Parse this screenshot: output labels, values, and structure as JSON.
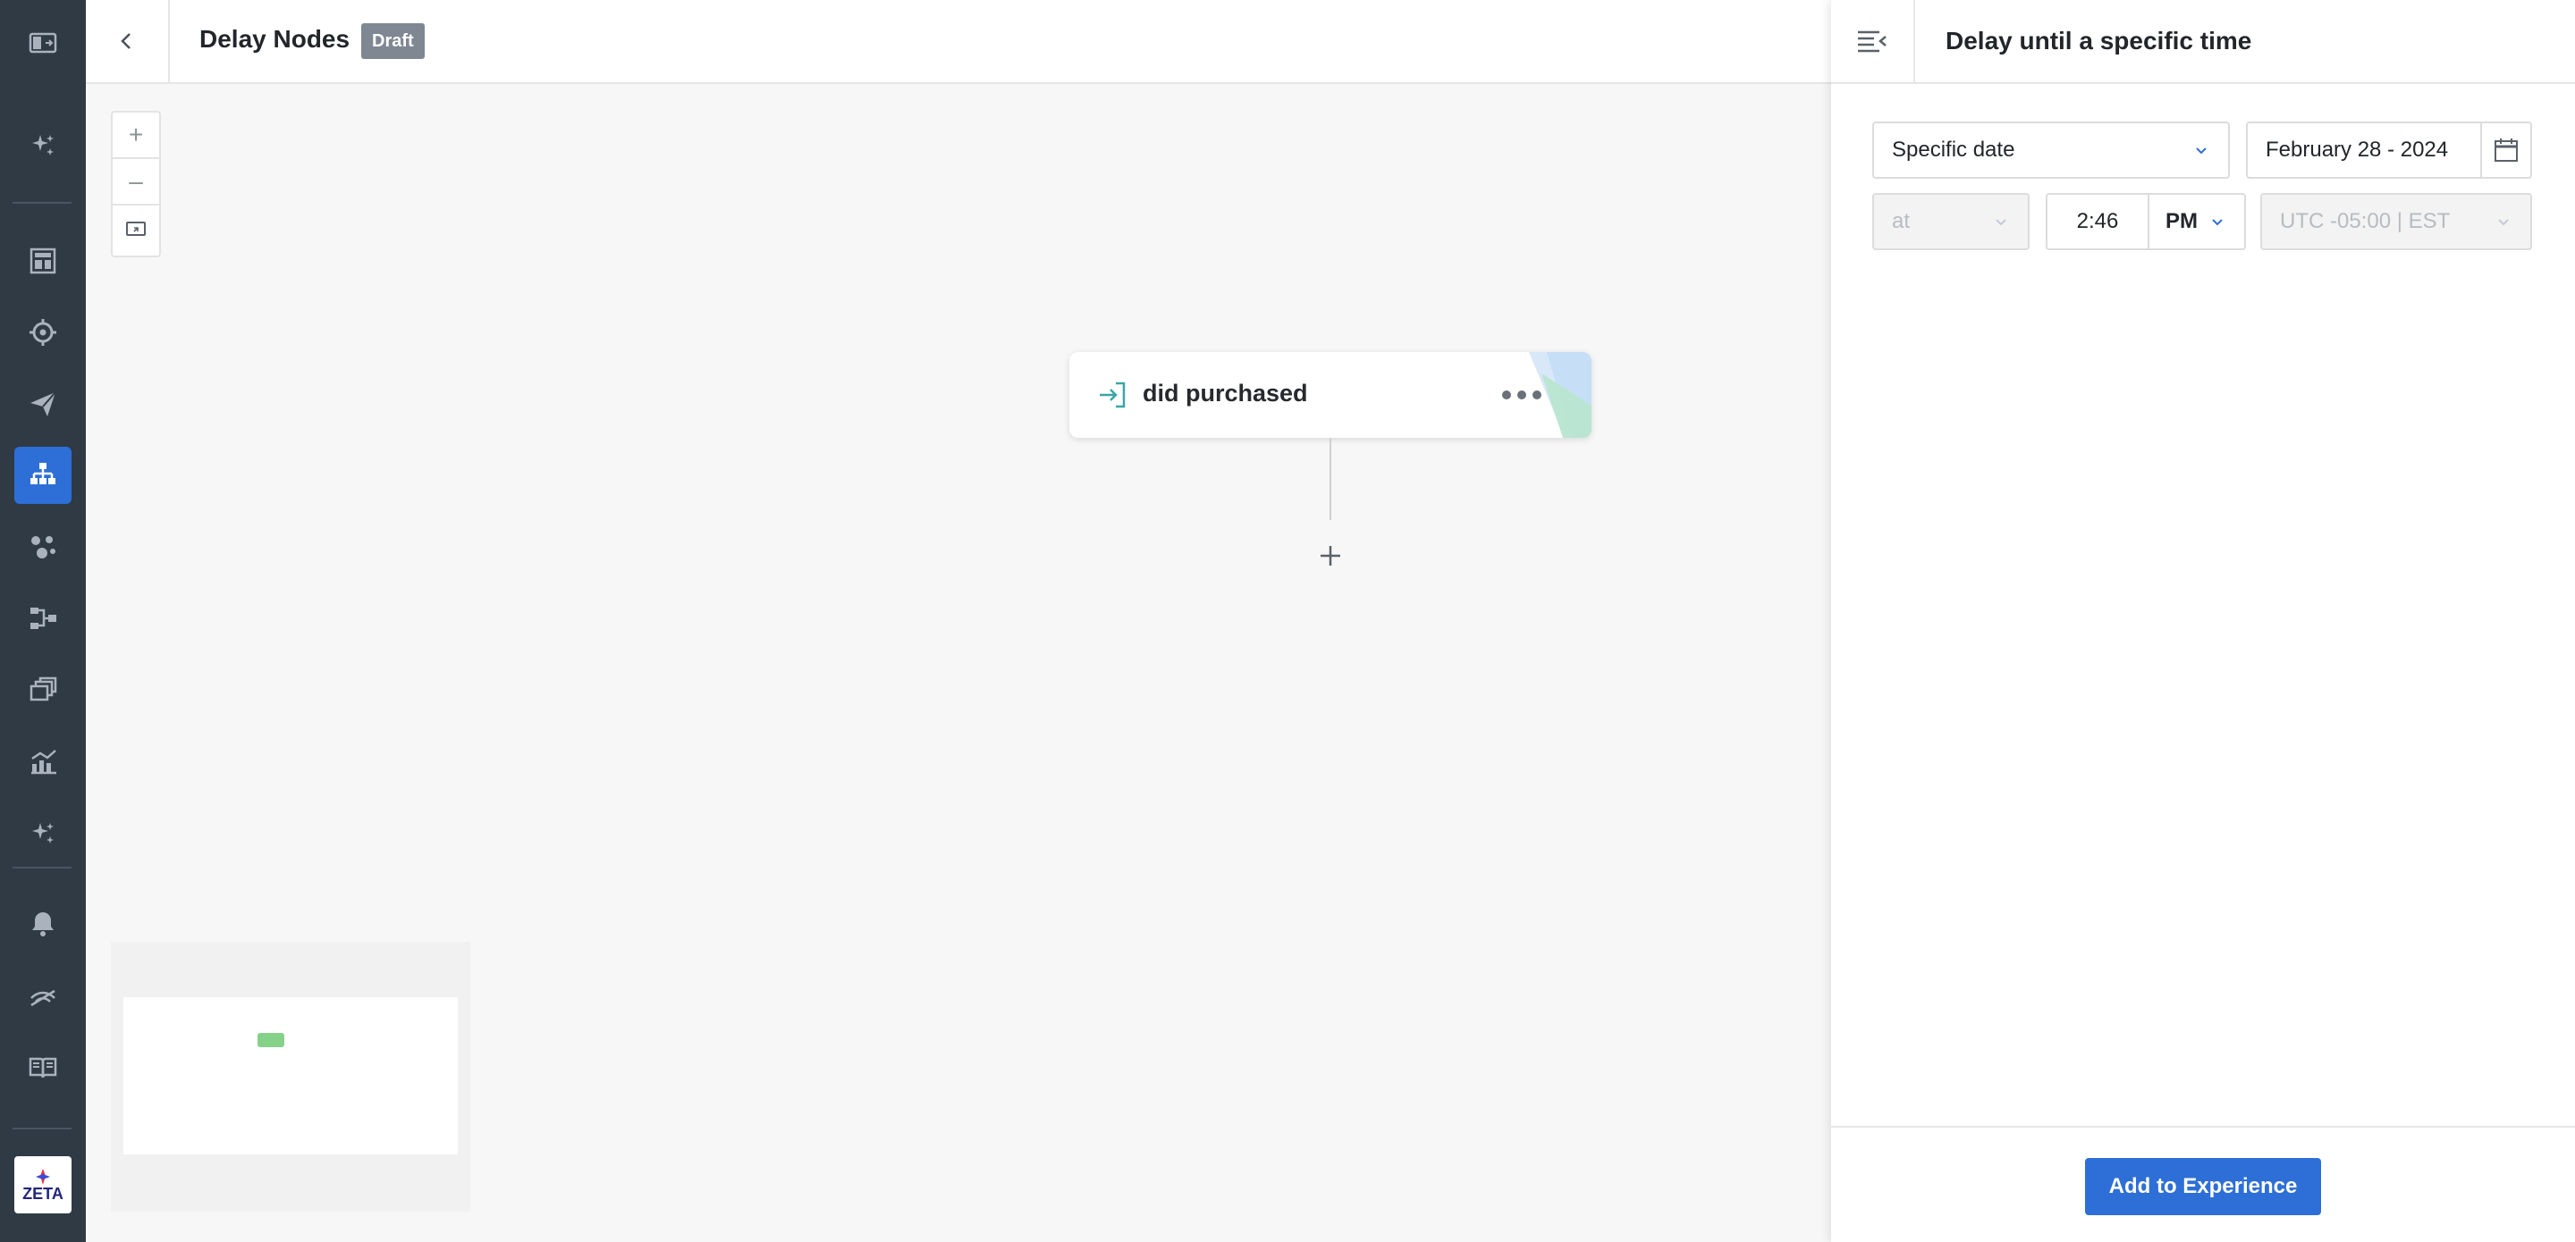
{
  "header": {
    "title": "Delay Nodes",
    "status_badge": "Draft"
  },
  "nav": {
    "items": [
      {
        "name": "app-switcher-icon"
      },
      {
        "name": "sparkle-icon"
      },
      {
        "name": "dashboard-icon"
      },
      {
        "name": "target-icon"
      },
      {
        "name": "send-icon"
      },
      {
        "name": "experiences-icon",
        "active": true
      },
      {
        "name": "audience-icon"
      },
      {
        "name": "flow-icon"
      },
      {
        "name": "content-icon"
      },
      {
        "name": "analytics-icon"
      },
      {
        "name": "ai-icon"
      },
      {
        "name": "bell-icon"
      },
      {
        "name": "signal-icon"
      },
      {
        "name": "docs-icon"
      }
    ],
    "logo_text": "ZETA"
  },
  "canvas": {
    "zoom_in": "+",
    "zoom_out": "–",
    "node": {
      "label": "did purchased",
      "icon": "entry-icon",
      "accent_colors": [
        "#a8e0c4",
        "#c6dff7"
      ]
    }
  },
  "panel": {
    "title": "Delay until a specific time",
    "delay_type": "Specific date",
    "date": "February 28 - 2024",
    "at_label": "at",
    "time": "2:46",
    "meridiem": "PM",
    "timezone": "UTC -05:00 | EST",
    "submit_label": "Add to Experience"
  },
  "colors": {
    "rail_bg": "#2f3a45",
    "accent": "#2d6fd6",
    "badge_bg": "#7e8792"
  }
}
